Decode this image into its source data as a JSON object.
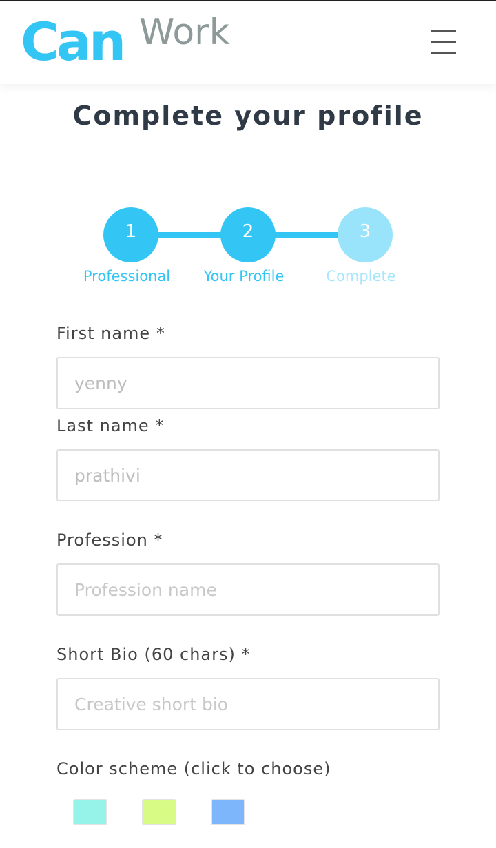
{
  "header": {
    "logo_can": "Can",
    "logo_work": "Work"
  },
  "page_title": "Complete your profile",
  "stepper": {
    "steps": [
      {
        "number": "1",
        "label": "Professional",
        "color": "#33c6f4",
        "label_color": "#33c6f4"
      },
      {
        "number": "2",
        "label": "Your Profile",
        "color": "#33c6f4",
        "label_color": "#33c6f4"
      },
      {
        "number": "3",
        "label": "Complete",
        "color": "#99e4fb",
        "label_color": "#a8e6fb"
      }
    ]
  },
  "form": {
    "first_name": {
      "label": "First name *",
      "value": "yenny"
    },
    "last_name": {
      "label": "Last name *",
      "value": "prathivi"
    },
    "profession": {
      "label": "Profession *",
      "placeholder": "Profession name"
    },
    "short_bio": {
      "label": "Short Bio (60 chars) *",
      "placeholder": "Creative short bio"
    },
    "color_scheme": {
      "label": "Color scheme (click to choose)",
      "swatches": [
        "#95f3ea",
        "#d7fb85",
        "#7db6fb"
      ]
    }
  }
}
